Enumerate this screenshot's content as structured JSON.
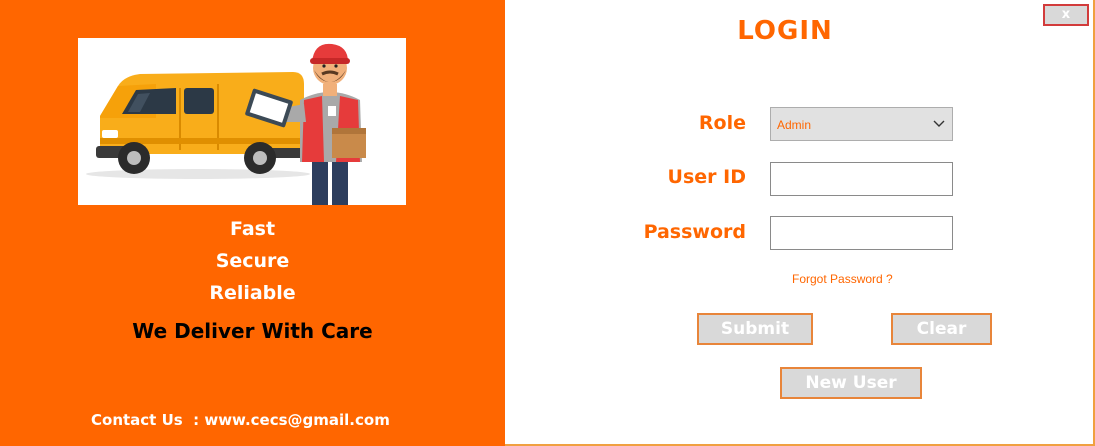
{
  "branding": {
    "taglines": [
      "Fast",
      "Secure",
      "Reliable"
    ],
    "slogan": "We Deliver With Care",
    "contact": "Contact Us  : www.cecs@gmail.com"
  },
  "login": {
    "title": "LOGIN",
    "close_label": "x",
    "role_label": "Role",
    "role_value": "Admin",
    "userid_label": "User ID",
    "userid_value": "",
    "password_label": "Password",
    "password_value": "",
    "forgot_label": "Forgot Password ?",
    "submit_label": "Submit",
    "clear_label": "Clear",
    "newuser_label": "New User"
  },
  "colors": {
    "accent": "#ff6600",
    "button_bg": "#d9d9d9",
    "button_border": "#e8853a"
  },
  "icons": {
    "hero": "delivery-van-courier-illustration",
    "dropdown": "chevron-down-icon"
  }
}
